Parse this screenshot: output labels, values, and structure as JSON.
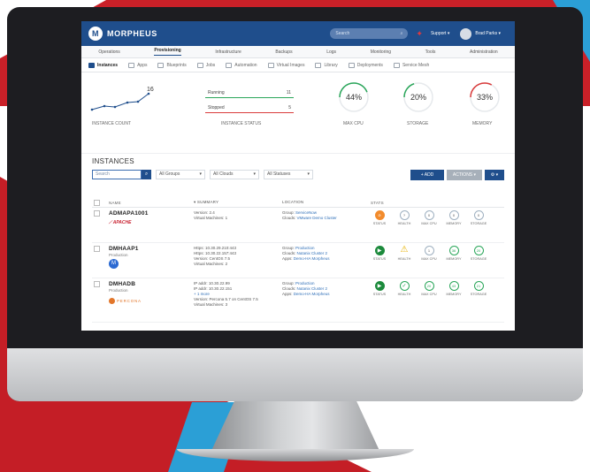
{
  "app": {
    "brand": "MORPHEUS"
  },
  "header": {
    "search_placeholder": "Search",
    "support": "Support",
    "user": "Brad Parks"
  },
  "main_nav": [
    "Operations",
    "Provisioning",
    "Infrastructure",
    "Backups",
    "Logs",
    "Monitoring",
    "Tools",
    "Administration"
  ],
  "sub_nav": [
    "Instances",
    "Apps",
    "Blueprints",
    "Jobs",
    "Automation",
    "Virtual Images",
    "Library",
    "Deployments",
    "Service Mesh"
  ],
  "widgets": {
    "instance_count": {
      "value": "16",
      "label": "INSTANCE COUNT"
    },
    "instance_status": {
      "label": "INSTANCE STATUS",
      "running_label": "Running",
      "running": "11",
      "stopped_label": "Stopped",
      "stopped": "5"
    },
    "max_cpu": {
      "value": "44%",
      "label": "MAX CPU",
      "fraction": 0.44
    },
    "storage": {
      "value": "20%",
      "label": "STORAGE",
      "fraction": 0.2
    },
    "memory": {
      "value": "33%",
      "label": "MEMORY",
      "fraction": 0.33
    }
  },
  "instances": {
    "title": "INSTANCES",
    "search_placeholder": "Search",
    "filters": [
      "All Groups",
      "All Clouds",
      "All Statuses"
    ],
    "add_button": "+ ADD",
    "actions_button": "ACTIONS",
    "columns": {
      "name": "NAME",
      "summary": "SUMMARY",
      "location": "LOCATION",
      "stats": "STATS"
    },
    "stat_labels": [
      "STATUS",
      "HEALTH",
      "MAX CPU",
      "MEMORY",
      "STORAGE"
    ],
    "rows": [
      {
        "name": "ADMAPA1001",
        "env": "",
        "logo": "APACHE",
        "summary": [
          "Version: 2.4",
          "Virtual Machines: 1"
        ],
        "more": "",
        "group": "ServiceNow",
        "cloud": "VMware Demo Cluster",
        "apps": "",
        "stats": [
          "",
          "",
          "0",
          "0",
          "0"
        ]
      },
      {
        "name": "DMHAAP1",
        "env": "Production",
        "logo": "",
        "summary": [
          "Https: 10.30.29.210:443",
          "Https: 10.30.22.157:443",
          "Version: CentOS 7.5",
          "Virtual Machines: 2"
        ],
        "more": "",
        "group": "Production",
        "cloud": "Nutanix Cluster 2",
        "apps": "Demo-HA Morpheus",
        "stats": [
          "",
          "",
          "1",
          "36",
          "20"
        ]
      },
      {
        "name": "DMHADB",
        "env": "Production",
        "logo": "PERCONA",
        "summary": [
          "IP addr: 10.30.22.99",
          "IP addr: 10.30.22.151"
        ],
        "more": "+ 1 more",
        "summary2": [
          "Version: Percona 5.7 on CentOS 7.5",
          "Virtual Machines: 3"
        ],
        "group": "Production",
        "cloud": "Nutanix Cluster 2",
        "apps": "Demo-HA Morpheus",
        "stats": [
          "",
          "",
          "20",
          "43",
          "21"
        ]
      }
    ],
    "row_labels": {
      "group": "Group:",
      "cloud": "Clouds:",
      "apps": "Apps:"
    }
  }
}
